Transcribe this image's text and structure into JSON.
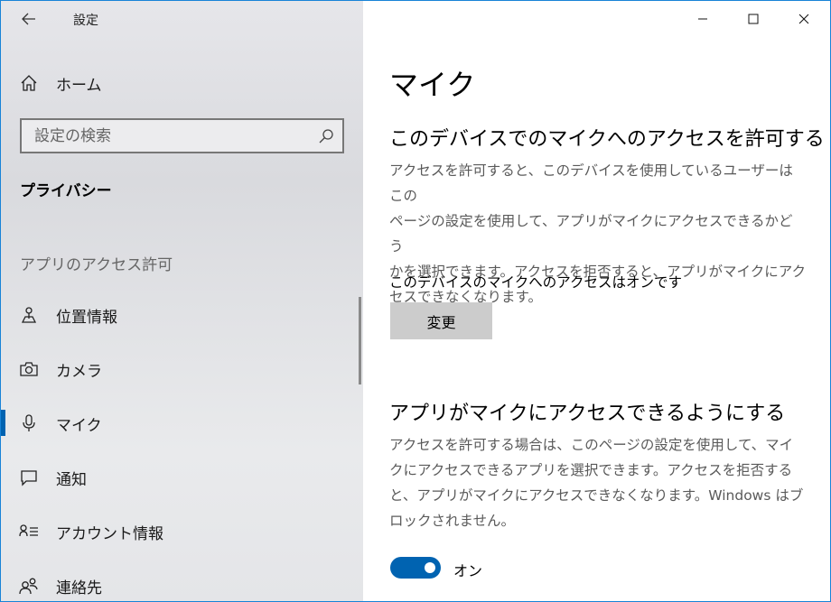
{
  "window": {
    "app_title": "設定",
    "caption_buttons": [
      "minimize",
      "maximize",
      "close"
    ]
  },
  "sidebar": {
    "home_label": "ホーム",
    "search_placeholder": "設定の検索",
    "section_title": "プライバシー",
    "group_label": "アプリのアクセス許可",
    "items": [
      {
        "label": "位置情報",
        "icon": "location-icon"
      },
      {
        "label": "カメラ",
        "icon": "camera-icon"
      },
      {
        "label": "マイク",
        "icon": "microphone-icon",
        "active": true
      },
      {
        "label": "通知",
        "icon": "notification-icon"
      },
      {
        "label": "アカウント情報",
        "icon": "account-info-icon"
      },
      {
        "label": "連絡先",
        "icon": "contacts-icon"
      }
    ]
  },
  "main": {
    "title": "マイク",
    "device_section": {
      "heading": "このデバイスでのマイクへのアクセスを許可する",
      "description": [
        "アクセスを許可すると、このデバイスを使用しているユーザーはこの",
        "ページの設定を使用して、アプリがマイクにアクセスできるかどう",
        "かを選択できます。アクセスを拒否すると、アプリがマイクにアク",
        "セスできなくなります。"
      ],
      "status": "このデバイスのマイクへのアクセスはオンです",
      "button_label": "変更"
    },
    "apps_section": {
      "heading": "アプリがマイクにアクセスできるようにする",
      "description": [
        "アクセスを許可する場合は、このページの設定を使用して、マイ",
        "クにアクセスできるアプリを選択できます。アクセスを拒否する",
        "と、アプリがマイクにアクセスできなくなります。Windows はブ",
        "ロックされません。"
      ],
      "toggle_state": "オン",
      "toggle_on": true
    }
  },
  "colors": {
    "accent": "#0063b1",
    "border": "#1883d7",
    "button_bg": "#cccccc"
  }
}
